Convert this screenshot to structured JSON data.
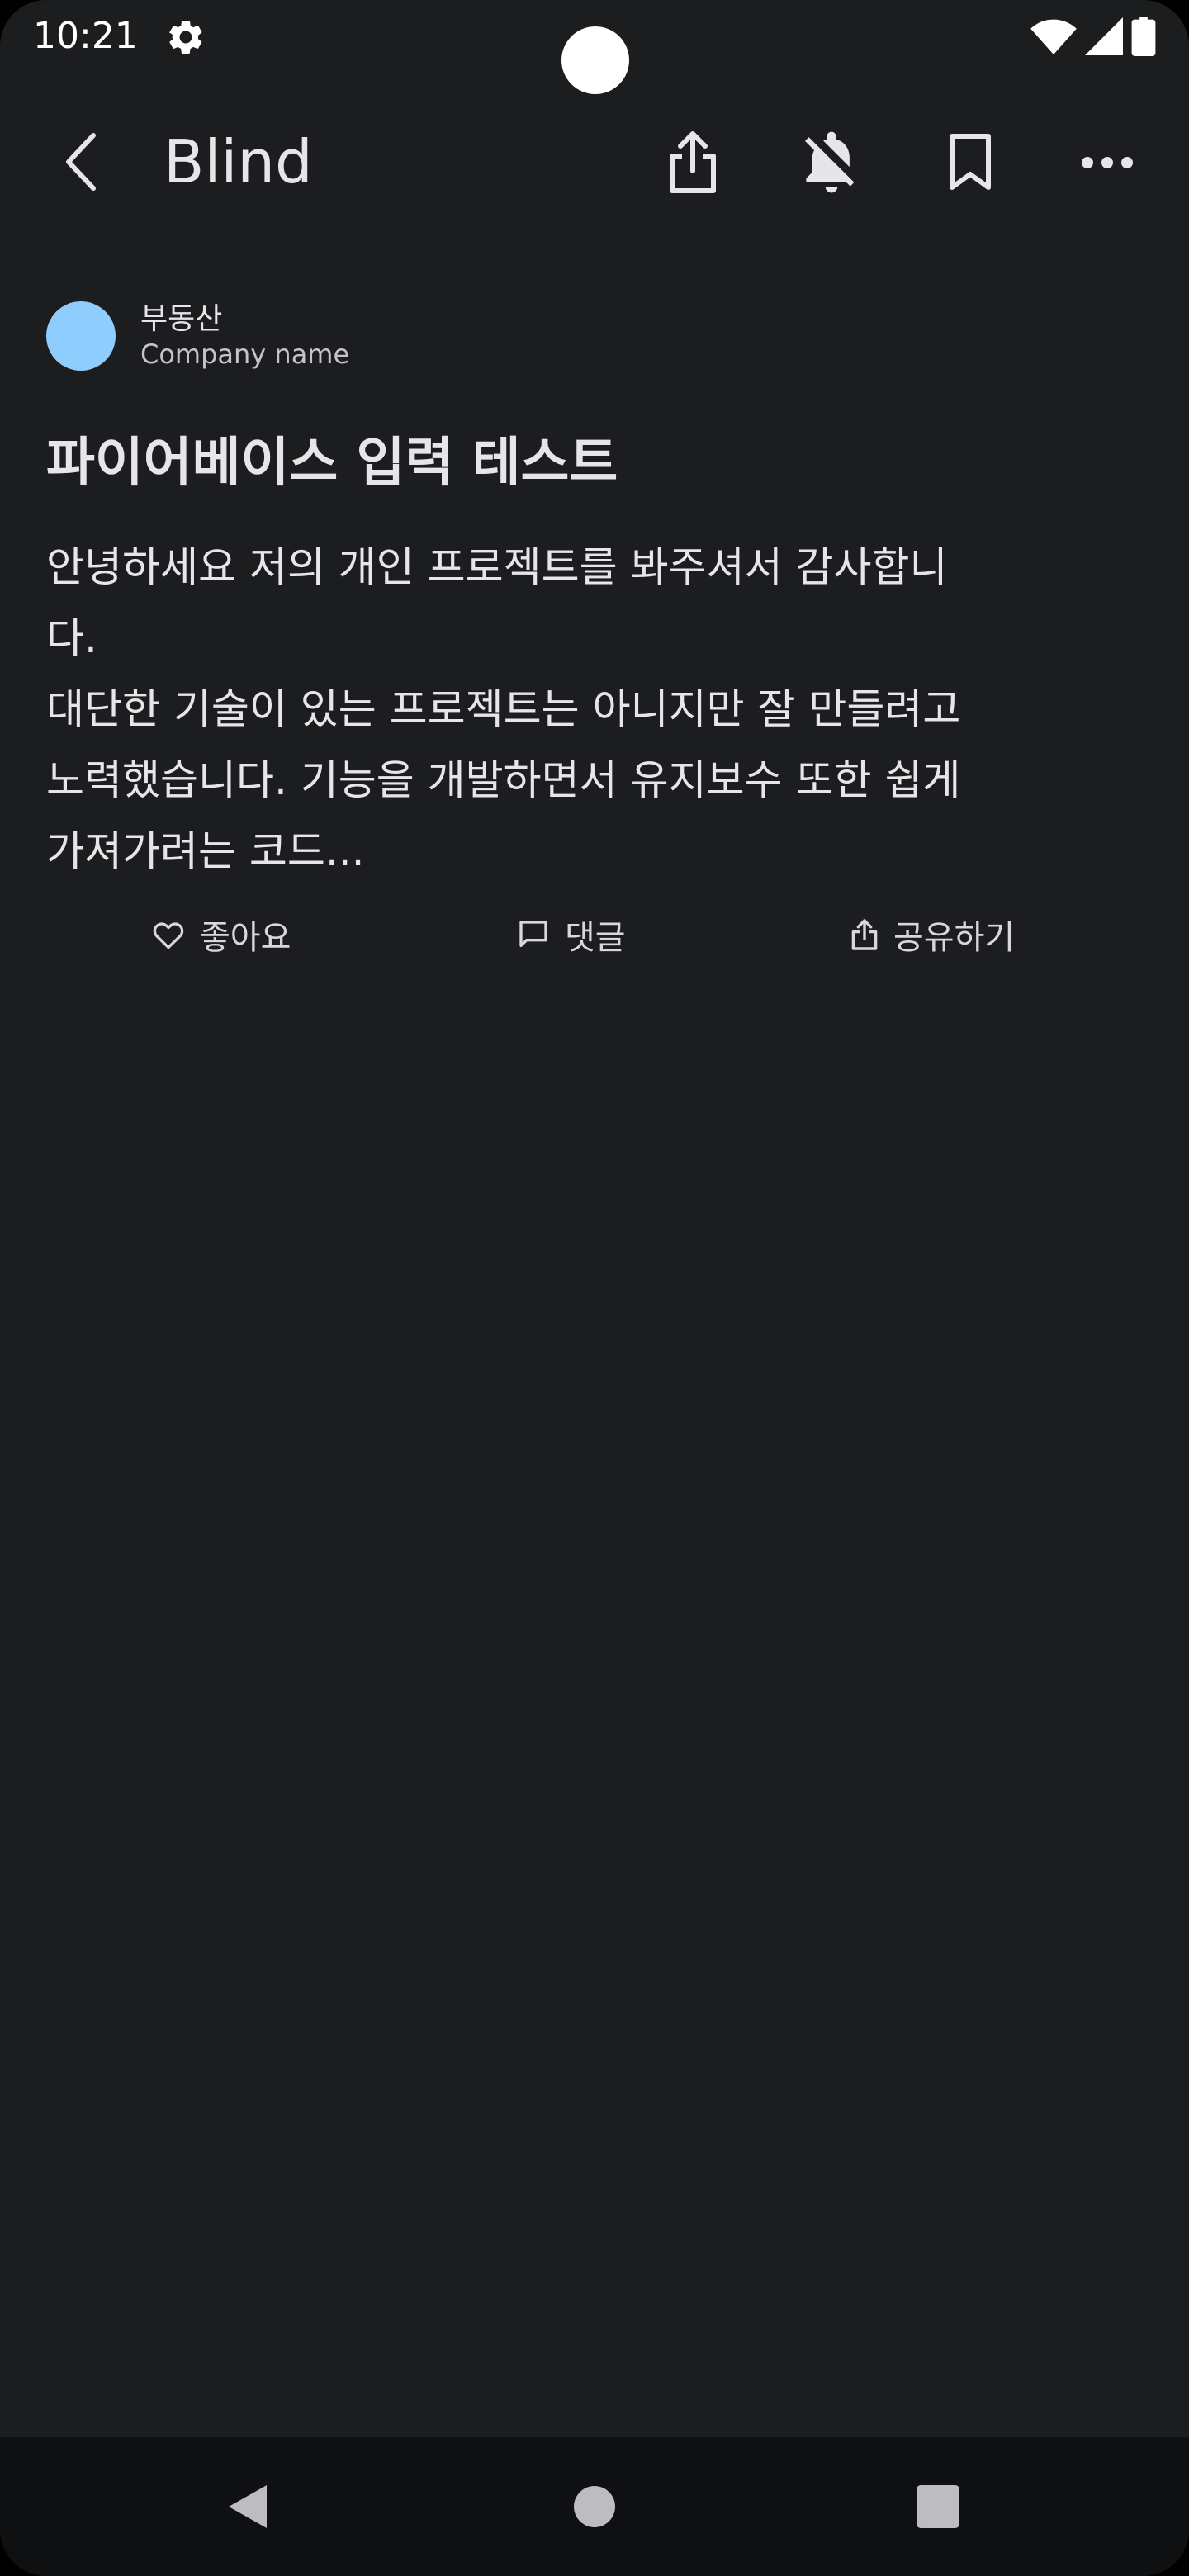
{
  "status_bar": {
    "time": "10:21",
    "icons": [
      "settings-icon",
      "wifi-icon",
      "signal-icon",
      "battery-icon"
    ]
  },
  "app_bar": {
    "title": "Blind",
    "actions": [
      "share-icon",
      "notifications-off-icon",
      "bookmark-icon",
      "more-icon"
    ]
  },
  "post": {
    "author": "부동산",
    "company": "Company name",
    "avatar_color": "#8ecdfd",
    "title": "파이어베이스 입력 테스트",
    "body_lines": [
      "안녕하세요 저의 개인 프로젝트를 봐주셔서 감사합니",
      "다.",
      "대단한 기술이 있는 프로젝트는 아니지만 잘 만들려고",
      "노력했습니다. 기능을 개발하면서 유지보수 또한 쉽게",
      "가져가려는 코드..."
    ]
  },
  "reactions": {
    "like_label": "좋아요",
    "comment_label": "댓글",
    "share_label": "공유하기"
  },
  "nav_bar": {
    "icons": [
      "back-triangle-icon",
      "home-circle-icon",
      "recents-square-icon"
    ]
  },
  "colors": {
    "background": "#1c1d1f",
    "text": "#e6e6e8",
    "nav_background": "#0f1012"
  }
}
